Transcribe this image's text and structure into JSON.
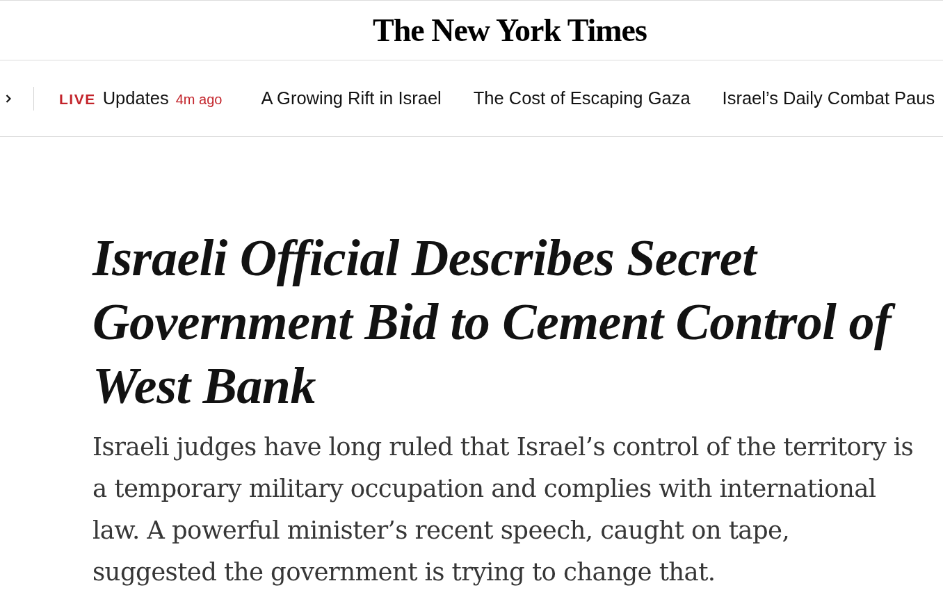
{
  "masthead": {
    "logo": "The New York Times"
  },
  "nav": {
    "items": [
      {
        "kind": "live",
        "badge": "LIVE",
        "label": "Updates",
        "time": "4m ago"
      },
      {
        "kind": "link",
        "label": "A Growing Rift in Israel"
      },
      {
        "kind": "link",
        "label": "The Cost of Escaping Gaza"
      },
      {
        "kind": "link",
        "label": "Israel’s Daily Combat Paus"
      }
    ]
  },
  "article": {
    "headline": "Israeli Official Describes Secret Government Bid to Cement Control of West Bank",
    "summary": "Israeli judges have long ruled that Israel’s control of the territory is a temporary military occupation and complies with international law. A powerful minister’s recent speech, caught on tape, suggested the government is trying to change that."
  }
}
